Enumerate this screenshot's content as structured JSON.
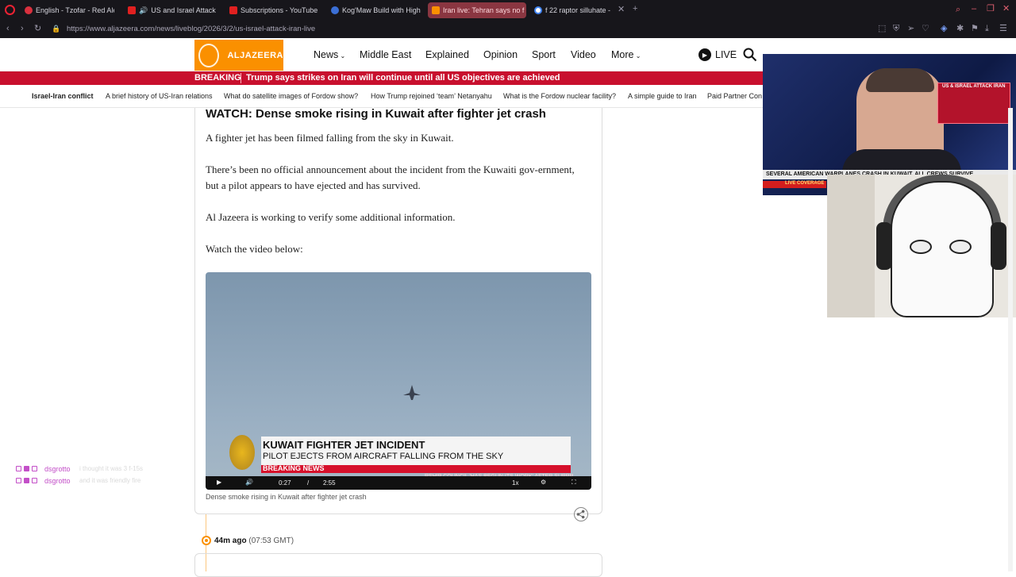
{
  "browser": {
    "tabs": [
      {
        "title": "English - Tzofar - Red Alert",
        "color": "#d9303e"
      },
      {
        "title": "US and Israel Attack Ir",
        "color": "#e02020"
      },
      {
        "title": "Subscriptions - YouTube",
        "color": "#e02020"
      },
      {
        "title": "Kog'Maw Build with Highe",
        "color": "#3b6fd6"
      },
      {
        "title": "Iran live: Tehran says no f",
        "color": "#fa9000"
      },
      {
        "title": "f 22 raptor silluhate - G",
        "color": "#ffffff"
      }
    ],
    "url": "https://www.aljazeera.com/news/liveblog/2026/3/2/us-israel-attack-iran-live"
  },
  "site": {
    "logo_text": "ALJAZEERA",
    "nav": [
      "News",
      "Middle East",
      "Explained",
      "Opinion",
      "Sport",
      "Video",
      "More"
    ],
    "live_label": "LIVE",
    "breaking_label": "BREAKING",
    "breaking_headline": "Trump says strikes on Iran will continue until all US objectives are achieved",
    "subnav": [
      "Israel-Iran conflict",
      "A brief history of US-Iran relations",
      "What do satellite images of Fordow show?",
      "How Trump rejoined ‘team’ Netanyahu",
      "What is the Fordow nuclear facility?",
      "A simple guide to Iran",
      "Paid Partner Con"
    ]
  },
  "article": {
    "headline": "WATCH: Dense smoke rising in Kuwait after fighter jet crash",
    "paragraphs": [
      "A fighter jet has been filmed falling from the sky in Kuwait.",
      "There’s been no official announcement about the incident from the Kuwaiti gov-ernment, but a pilot appears to have ejected and has survived.",
      "Al Jazeera is working to verify some additional information.",
      "Watch the video below:"
    ],
    "video": {
      "lower_third_title": "KUWAIT FIGHTER JET INCIDENT",
      "lower_third_sub": "PILOT EJECTS FROM AIRCRAFT FALLING FROM THE SKY",
      "breaking": "BREAKING NEWS",
      "ticker": "RSHIP COUNCIL 'HAS BEGUN ITS WORK' AFTER SUPPR",
      "current_time": "0:27",
      "duration": "2:55",
      "speed": "1x"
    },
    "caption": "Dense smoke rising in Kuwait after fighter jet crash",
    "next_time_ago": "44m ago",
    "next_time_gmt": "(07:53 GMT)"
  },
  "overlay": {
    "badge_text": "US & ISRAEL ATTACK IRAN",
    "ticker": "SEVERAL AMERICAN WARPLANES CRASH IN KUWAIT, ALL CREWS SURVIVE",
    "live_coverage": "LIVE COVERAGE"
  },
  "chat": [
    {
      "user": "dsgrotto",
      "message": "i thought it was 3 f-15s"
    },
    {
      "user": "dsgrotto",
      "message": "and it was friendly fire"
    }
  ]
}
